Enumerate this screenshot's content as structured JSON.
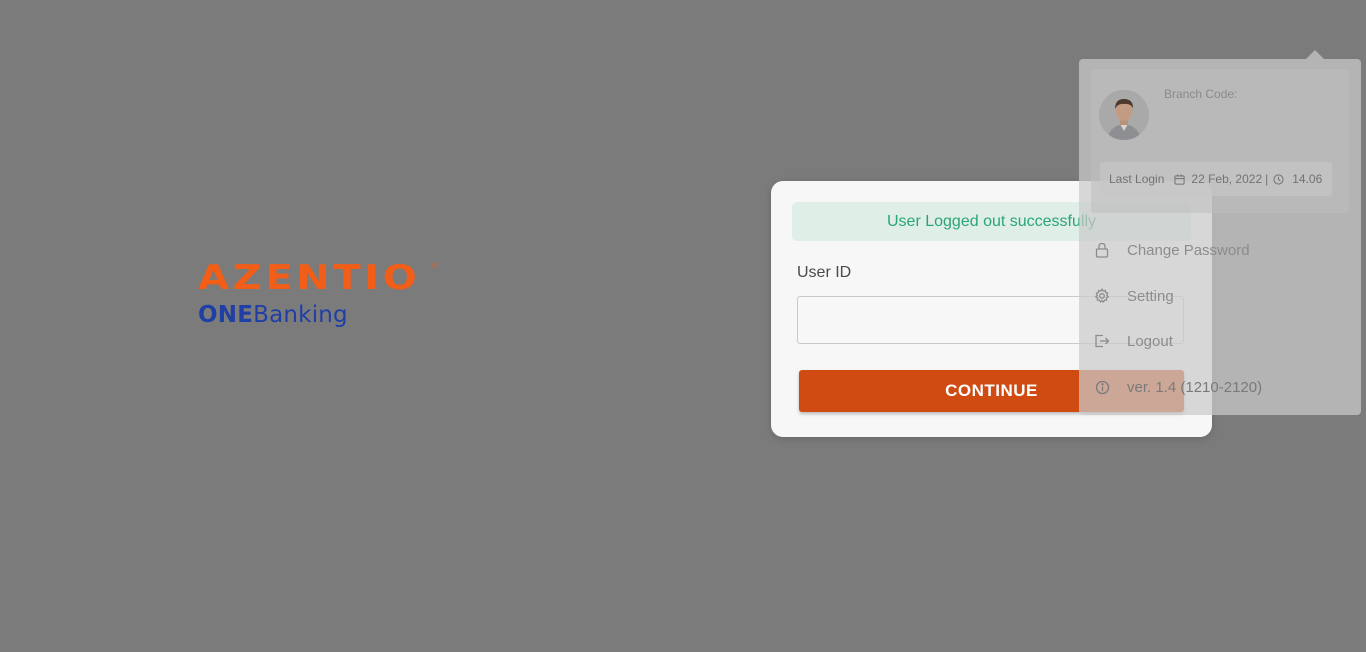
{
  "logo": {
    "brand": "AZENTIO",
    "tm": "®",
    "product_one": "ONE",
    "product_banking": "Banking"
  },
  "login": {
    "alert": "User Logged out successfully",
    "user_id_label": "User ID",
    "user_id_value": "",
    "continue_label": "CONTINUE"
  },
  "profile_menu": {
    "branch_code_label": "Branch Code:",
    "last_login_label": "Last Login",
    "last_login_date": "22 Feb, 2022",
    "separator": "|",
    "last_login_time": "14.06",
    "items": [
      {
        "label": "Change Password",
        "icon": "lock-icon"
      },
      {
        "label": "Setting",
        "icon": "gear-icon"
      },
      {
        "label": "Logout",
        "icon": "logout-icon"
      },
      {
        "label": "ver. 1.4 (1210-2120)",
        "icon": "info-icon"
      }
    ]
  },
  "colors": {
    "backdrop": "#7b7b7b",
    "brand_orange": "#f25d18",
    "brand_blue": "#1f3fa6",
    "button": "#cf4b12",
    "success_text": "#2aa675",
    "success_bg": "#dfeee7"
  }
}
